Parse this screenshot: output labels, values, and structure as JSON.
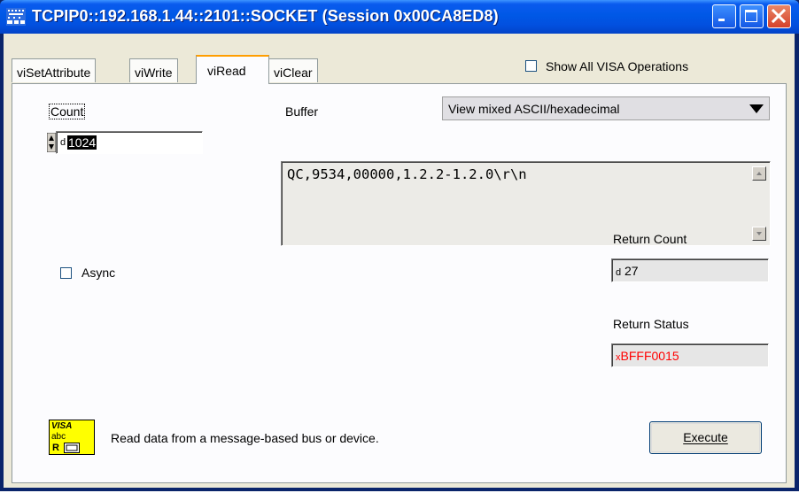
{
  "window": {
    "title": "TCPIP0::192.168.1.44::2101::SOCKET (Session 0x00CA8ED8)",
    "icon": "ni-visa-app-icon",
    "controls": [
      "minimize-icon",
      "maximize-icon",
      "close-icon"
    ]
  },
  "tabs": [
    {
      "label": "viSetAttribute",
      "active": false
    },
    {
      "label": "viWrite",
      "active": false
    },
    {
      "label": "viRead",
      "active": true
    },
    {
      "label": "viClear",
      "active": false
    }
  ],
  "show_all": {
    "label": "Show All VISA Operations",
    "checked": false
  },
  "count": {
    "label": "Count",
    "value": "1024",
    "type_glyph": "d"
  },
  "buffer": {
    "label": "Buffer",
    "view_mode": "View mixed ASCII/hexadecimal",
    "content": "QC,9534,00000,1.2.2-1.2.0\\r\\n"
  },
  "async": {
    "label": "Async",
    "checked": false
  },
  "return_count": {
    "label": "Return Count",
    "value": "27",
    "type_glyph": "d"
  },
  "return_status": {
    "label": "Return Status",
    "value": "BFFF0015",
    "error_glyph": "x",
    "color": "#ff0000"
  },
  "footer": {
    "description": "Read data from a message-based bus or device.",
    "execute_label": "Execute",
    "visa_icon": {
      "line1": "VISA",
      "line2": "abc",
      "line3": "R"
    }
  },
  "colors": {
    "titlebar": "#0058e6",
    "dialog_bg": "#ece9d8",
    "tab_active_accent": "#ff9e00",
    "error_text": "#ff0000",
    "visa_icon_bg": "#ffff00"
  }
}
